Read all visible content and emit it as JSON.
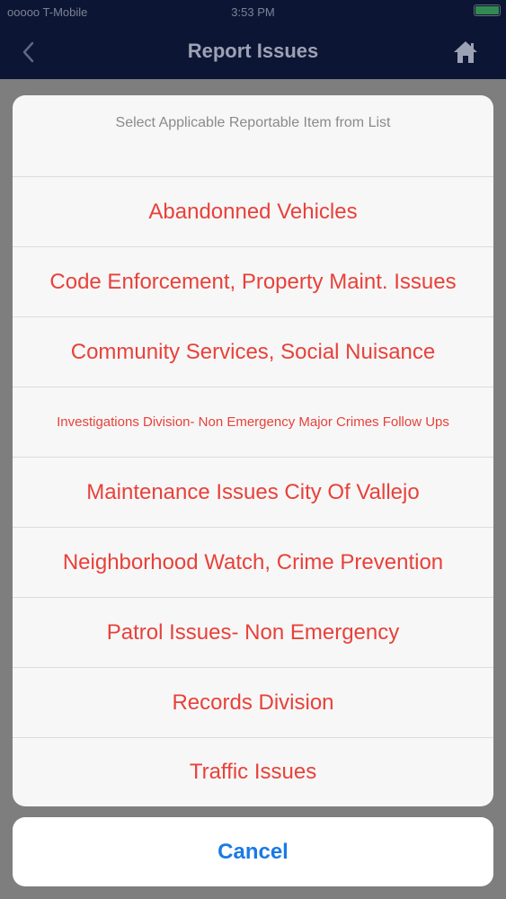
{
  "status_bar": {
    "carrier": "ooooo T-Mobile",
    "time": "3:53 PM",
    "battery_level": 1.0
  },
  "nav": {
    "title": "Report Issues",
    "back_icon": "chevron-left-icon",
    "home_icon": "home-icon"
  },
  "sheet": {
    "header": "Select Applicable Reportable Item from List",
    "options": [
      "Abandonned Vehicles",
      "Code Enforcement, Property Maint. Issues",
      "Community Services, Social Nuisance",
      "Investigations Division- Non Emergency Major Crimes Follow Ups",
      "Maintenance Issues City Of Vallejo",
      "Neighborhood Watch, Crime Prevention",
      "Patrol Issues- Non Emergency",
      "Records Division",
      "Traffic Issues"
    ],
    "cancel_label": "Cancel"
  },
  "colors": {
    "nav_background": "#0c1534",
    "option_text": "#e8413a",
    "cancel_text": "#1a7ae6",
    "battery": "#4cd964"
  }
}
